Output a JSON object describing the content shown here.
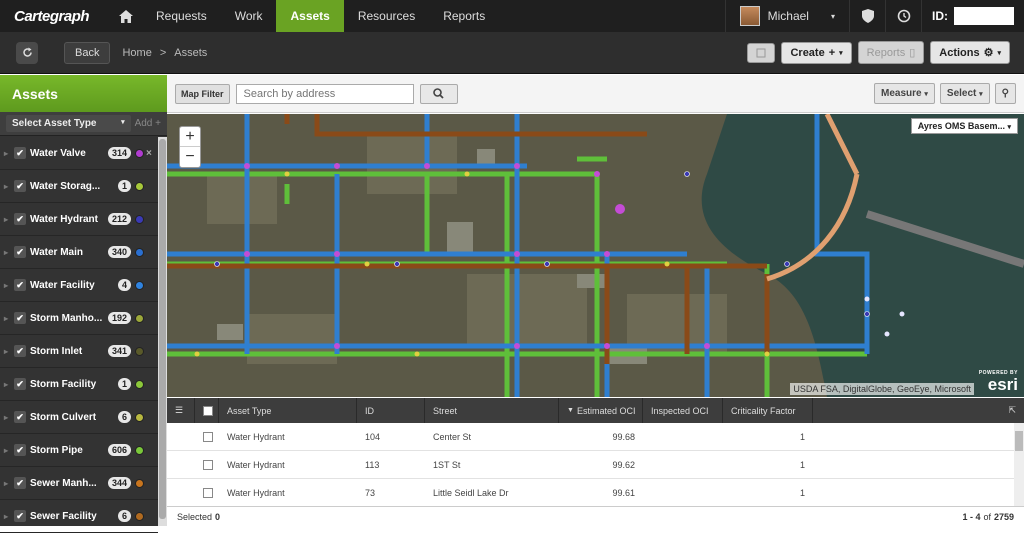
{
  "app": {
    "logo": "Cartegraph"
  },
  "nav": {
    "items": [
      "Requests",
      "Work",
      "Assets",
      "Resources",
      "Reports"
    ],
    "active": "Assets"
  },
  "user": {
    "name": "Michael",
    "id_label": "ID:"
  },
  "subbar": {
    "back": "Back",
    "breadcrumb": [
      "Home",
      ">",
      "Assets"
    ],
    "create": "Create",
    "reports": "Reports",
    "actions": "Actions"
  },
  "sidebar": {
    "title": "Assets",
    "select_type": "Select Asset Type",
    "add": "Add",
    "assets": [
      {
        "name": "Water Valve",
        "count": "314",
        "color": "#b03cd0"
      },
      {
        "name": "Water Storag...",
        "count": "1",
        "color": "#a7c83a"
      },
      {
        "name": "Water Hydrant",
        "count": "212",
        "color": "#3a3ab5"
      },
      {
        "name": "Water Main",
        "count": "340",
        "color": "#2a6fd0"
      },
      {
        "name": "Water Facility",
        "count": "4",
        "color": "#2f83e0"
      },
      {
        "name": "Storm Manho...",
        "count": "192",
        "color": "#9ca83a"
      },
      {
        "name": "Storm Inlet",
        "count": "341",
        "color": "#5a5a2a"
      },
      {
        "name": "Storm Facility",
        "count": "1",
        "color": "#8cc83a"
      },
      {
        "name": "Storm Culvert",
        "count": "6",
        "color": "#b8b840"
      },
      {
        "name": "Storm Pipe",
        "count": "606",
        "color": "#7ac83a"
      },
      {
        "name": "Sewer Manh...",
        "count": "344",
        "color": "#c8751e"
      },
      {
        "name": "Sewer Facility",
        "count": "6",
        "color": "#b06a20"
      }
    ]
  },
  "maptools": {
    "map_filter": "Map Filter",
    "search_placeholder": "Search by address",
    "measure": "Measure",
    "select": "Select"
  },
  "map": {
    "basemap": "Ayres OMS Basem...",
    "attribution": "USDA FSA, DigitalGlobe, GeoEye, Microsoft",
    "powered": "POWERED BY",
    "esri": "esri"
  },
  "grid": {
    "columns": [
      "Asset Type",
      "ID",
      "Street",
      "Estimated OCI",
      "Inspected OCI",
      "Criticality Factor"
    ],
    "rows": [
      {
        "type": "Water Hydrant",
        "id": "104",
        "street": "Center St",
        "est": "99.68",
        "insp": "",
        "crit": "1"
      },
      {
        "type": "Water Hydrant",
        "id": "113",
        "street": "1ST St",
        "est": "99.62",
        "insp": "",
        "crit": "1"
      },
      {
        "type": "Water Hydrant",
        "id": "73",
        "street": "Little Seidl Lake Dr",
        "est": "99.61",
        "insp": "",
        "crit": "1"
      }
    ],
    "selected_label": "Selected",
    "selected_count": "0",
    "paging": "1 - 4",
    "paging_of": "of",
    "total": "2759"
  }
}
